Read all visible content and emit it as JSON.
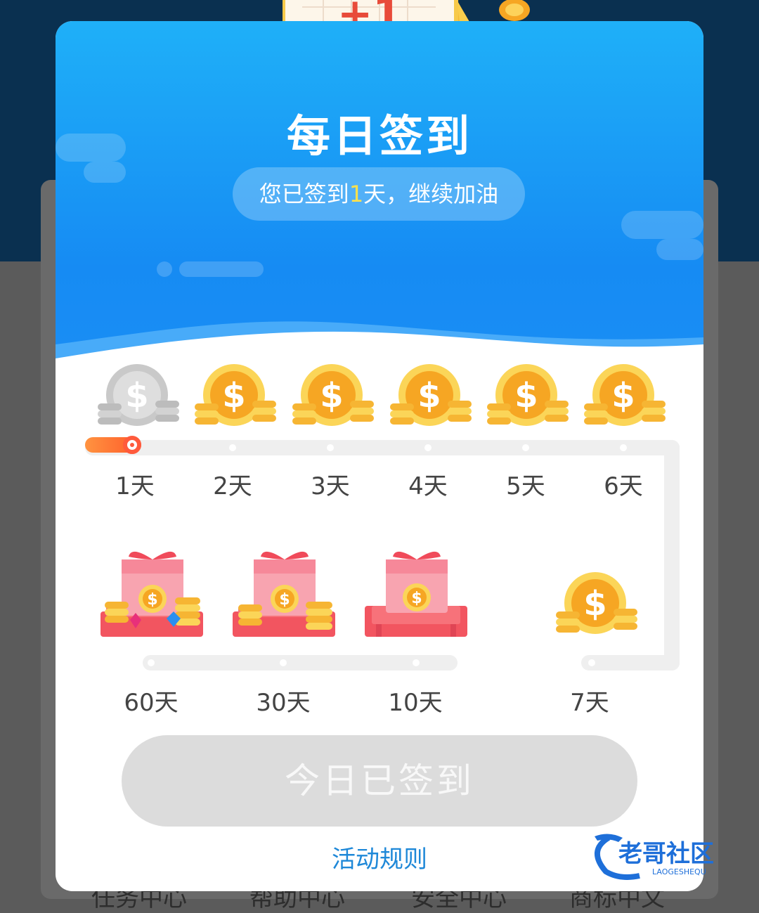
{
  "background": {
    "bottom_tabs": [
      "任务中心",
      "帮助中心",
      "安全中心",
      "商标中文"
    ]
  },
  "dialog": {
    "title": "每日签到",
    "subtitle_prefix": "您已签到",
    "subtitle_count": "1",
    "subtitle_suffix": "天，继续加油",
    "days_row1": [
      {
        "label": "1天",
        "reward": "silver-coin",
        "completed": true
      },
      {
        "label": "2天",
        "reward": "gold-coin",
        "completed": false
      },
      {
        "label": "3天",
        "reward": "gold-coin",
        "completed": false
      },
      {
        "label": "4天",
        "reward": "gold-coin",
        "completed": false
      },
      {
        "label": "5天",
        "reward": "gold-coin",
        "completed": false
      },
      {
        "label": "6天",
        "reward": "gold-coin",
        "completed": false
      }
    ],
    "days_row2": [
      {
        "label": "60天",
        "reward": "gift-box-gems"
      },
      {
        "label": "30天",
        "reward": "gift-box-coins"
      },
      {
        "label": "10天",
        "reward": "gift-box"
      },
      {
        "label": "7天",
        "reward": "gold-coin"
      }
    ],
    "checkin_button": "今日已签到",
    "rules_link": "活动规则"
  },
  "watermark": {
    "text": "老哥社区",
    "sub": "LAOGESHEQU"
  },
  "colors": {
    "header_top": "#1fb0f8",
    "header_bottom": "#168bf3",
    "progress": "#ff5a3c",
    "highlight": "#ffe14a",
    "link": "#1e88d8",
    "button_disabled": "#dcdcdc"
  }
}
